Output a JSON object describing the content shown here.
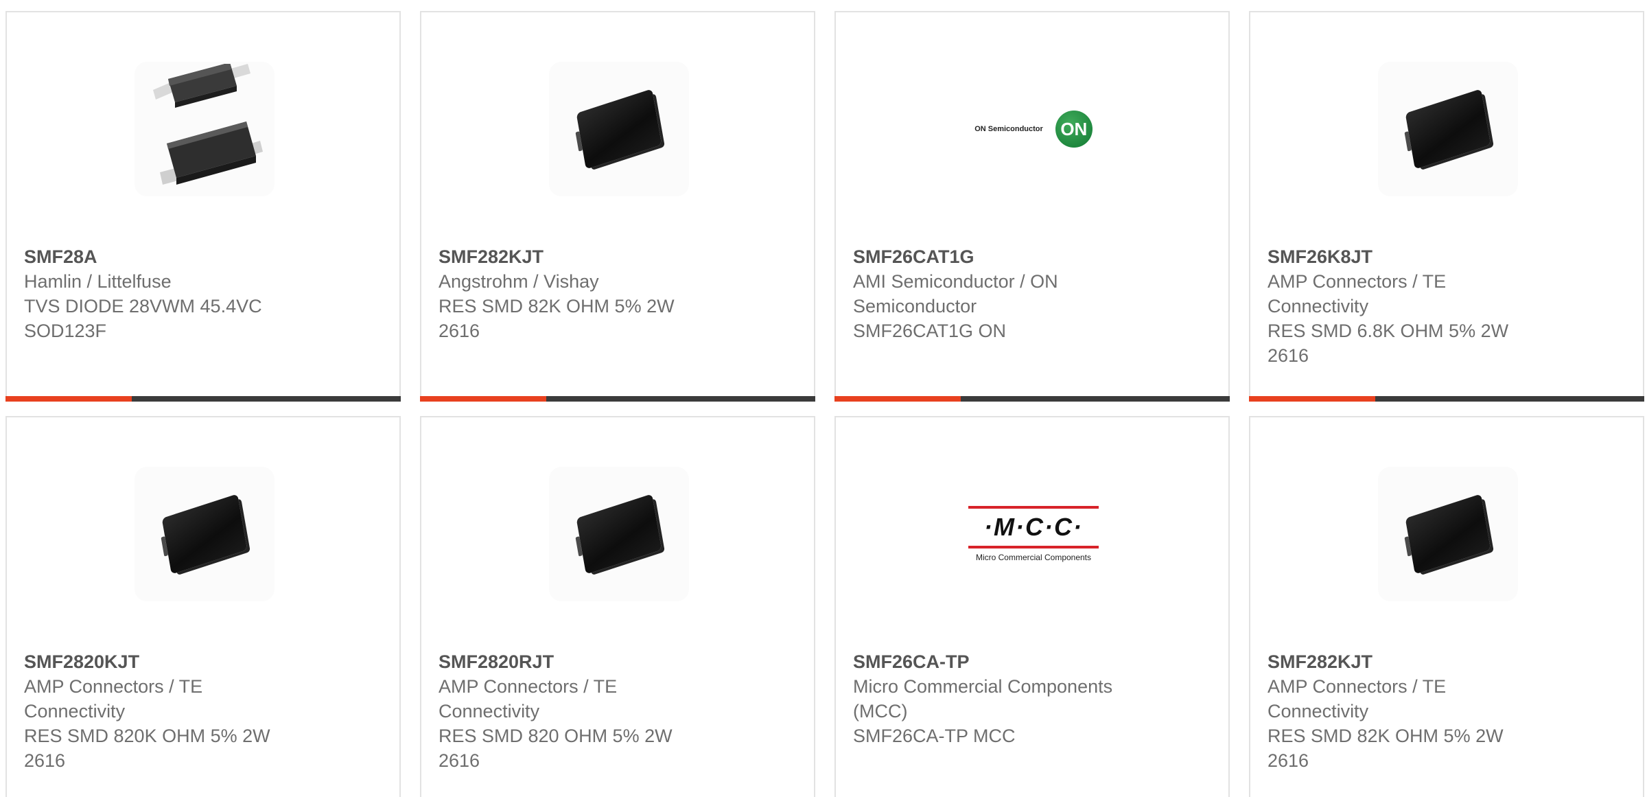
{
  "cards": [
    {
      "part": "SMF28A",
      "lines": [
        "Hamlin / Littelfuse",
        "TVS DIODE 28VWM 45.4VC",
        "SOD123F"
      ],
      "image": "sod123f-diode-image"
    },
    {
      "part": "SMF282KJT",
      "lines": [
        "Angstrohm / Vishay",
        "RES SMD 82K OHM 5% 2W",
        "2616"
      ],
      "image": "smd-resistor-image"
    },
    {
      "part": "SMF26CAT1G",
      "lines": [
        "AMI Semiconductor / ON",
        "Semiconductor",
        "SMF26CAT1G ON"
      ],
      "image": "on-semiconductor-logo",
      "logo_text": "ON Semiconductor",
      "logo_badge": "ON"
    },
    {
      "part": "SMF26K8JT",
      "lines": [
        "AMP Connectors / TE",
        "Connectivity",
        "RES SMD 6.8K OHM 5% 2W",
        "2616"
      ],
      "image": "smd-resistor-image"
    },
    {
      "part": "SMF2820KJT",
      "lines": [
        "AMP Connectors / TE",
        "Connectivity",
        "RES SMD 820K OHM 5% 2W",
        "2616"
      ],
      "image": "smd-resistor-image"
    },
    {
      "part": "SMF2820RJT",
      "lines": [
        "AMP Connectors / TE",
        "Connectivity",
        "RES SMD 820 OHM 5% 2W",
        "2616"
      ],
      "image": "smd-resistor-image"
    },
    {
      "part": "SMF26CA-TP",
      "lines": [
        "Micro Commercial Components",
        "(MCC)",
        "SMF26CA-TP MCC"
      ],
      "image": "mcc-logo",
      "logo_text": "·M·C·C·",
      "logo_sub": "Micro Commercial Components"
    },
    {
      "part": "SMF282KJT",
      "lines": [
        "AMP Connectors / TE",
        "Connectivity",
        "RES SMD 82K OHM 5% 2W",
        "2616"
      ],
      "image": "smd-resistor-image"
    }
  ],
  "colors": {
    "accent": "#e8411f",
    "bar": "#3b3b3b",
    "text": "#6e6e6e",
    "border": "#e2e2e2"
  }
}
